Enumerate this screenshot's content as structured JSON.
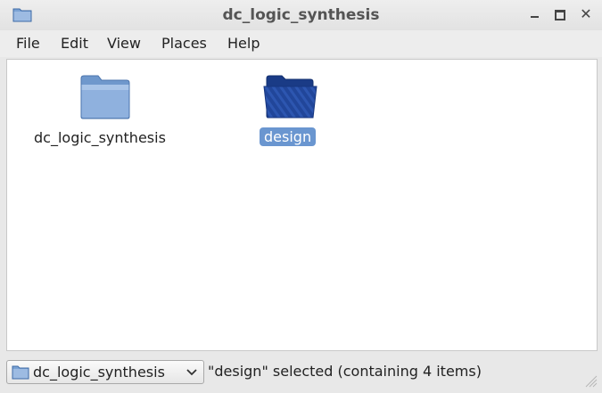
{
  "window": {
    "title": "dc_logic_synthesis",
    "controls": [
      "minimize",
      "maximize",
      "close"
    ]
  },
  "menubar": {
    "items": [
      "File",
      "Edit",
      "View",
      "Places",
      "Help"
    ]
  },
  "files": [
    {
      "name": "dc_logic_synthesis",
      "icon": "folder-icon",
      "selected": false
    },
    {
      "name": "design",
      "icon": "folder-icon",
      "selected": true
    }
  ],
  "statusbar": {
    "location": "dc_logic_synthesis",
    "status": "\"design\" selected (containing 4 items)"
  },
  "colors": {
    "selection": "#6a96d0",
    "folder": "#7fa6d6",
    "folder_selected": "#1f3f93"
  }
}
